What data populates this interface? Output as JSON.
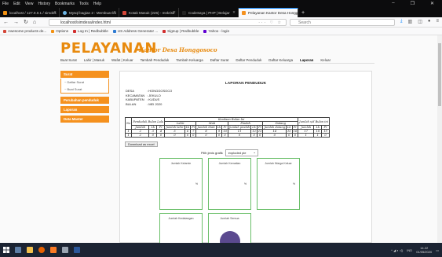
{
  "browser": {
    "menu": [
      "File",
      "Edit",
      "View",
      "History",
      "Bookmarks",
      "Tools",
      "Help"
    ],
    "window_controls": [
      "–",
      "❐",
      "✕"
    ],
    "tabs": [
      {
        "title": "localhost / 127.0.0.1 / simdes",
        "color": "#f29111"
      },
      {
        "title": "Mysql bagian 2 : Membuat ko",
        "color": "#6cb4e4"
      },
      {
        "title": "Kotak Masuk (226) - mskrisk",
        "color": "#d44638"
      },
      {
        "title": "CodeSaya | PHP | Belajar",
        "color": "#222222"
      },
      {
        "title": "Pelayanan Kantor Desa Hongg",
        "color": "#f5911e",
        "active": true
      }
    ],
    "new_tab": "+",
    "url": "localhost/simdesa/index.html",
    "url_actions": "··· ♡ ☆",
    "search_placeholder": "Search",
    "bookmarks": [
      {
        "label": "Awesome products de...",
        "color": "#d44638"
      },
      {
        "label": "Options",
        "color": "#f29111"
      },
      {
        "label": "Log In | Redbubble",
        "color": "#d22e2e"
      },
      {
        "label": "US Address Generator ...",
        "color": "#2e7bd2"
      },
      {
        "label": "Signup | Redbubble",
        "color": "#d22e2e"
      },
      {
        "label": "Yahoo - login",
        "color": "#6001d2"
      }
    ]
  },
  "site": {
    "brand": "PELAYANAN",
    "brand_sub": "Kantor Desa Honggosoco",
    "nav": [
      "Buat Surat",
      "Lahir | Masuk",
      "Wafat | Keluar",
      "Tambah Penduduk",
      "Tambah Keluarga",
      "Daftar Surat",
      "Daftar Penduduk",
      "Daftar Keluarga",
      "Laporan",
      "Keluar"
    ],
    "nav_active": "Laporan",
    "sidebar": {
      "surat": "Surat",
      "surat_items": [
        "~ Daftar Surat",
        "~ Buat Surat"
      ],
      "items": [
        "Perubahan penduduk",
        "Laporan",
        "Data Master"
      ]
    }
  },
  "report": {
    "title": "LAPORAN PENDUDUK",
    "info": [
      {
        "label": "DESA",
        "value": ": HONGGOSOCO"
      },
      {
        "label": "KECAMATAN",
        "value": ": JEKULO"
      },
      {
        "label": "KABUPATEN",
        "value": ": KUDUS"
      },
      {
        "label": "BULAN",
        "value": ": MEI 2020"
      }
    ],
    "headers": {
      "no": "No",
      "awal": "Penduduk Bulan Lalu",
      "keadaan": "Keadaan Bulan Ini",
      "lahir": "Lahir",
      "mati": "Mati",
      "pindah": "Pindah",
      "datang": "Datang",
      "akhir": "Jumlah s/d Bulan ini",
      "jumlah": "Jumlah",
      "lk": "Lk",
      "pr": "Pr",
      "jlh_lahir": "Jumlah lahir",
      "jlh_mati": "Jumlah Mati",
      "jlh_pindah": "Jumlah pindah",
      "jlh_datang": "Jumlah datang"
    },
    "num_row": [
      "1",
      "2",
      "3",
      "4",
      "5",
      "6",
      "7",
      "8",
      "9",
      "10",
      "11",
      "12",
      "13",
      "14",
      "15",
      "16",
      "17",
      "18",
      "19"
    ],
    "data_row": [
      "1",
      "2",
      "0",
      "0",
      "0",
      "0",
      "0",
      "0",
      "0",
      "0",
      "0",
      "0",
      "0",
      "0",
      "0",
      "0",
      "1",
      "1",
      "0"
    ],
    "download": "Download as excel",
    "chart_label": "Pilih jenis grafik",
    "chart_type": "exploded pie",
    "cards": [
      "Jumlah Kelamin",
      "Jumlah Kematian",
      "Jumlah Warga Keluar",
      "Jumlah Kedatangan",
      "Jumlah Semua"
    ],
    "pct_label": "%"
  },
  "taskbar": {
    "lang": "IND",
    "time": "14.22",
    "date": "01/05/2020"
  }
}
